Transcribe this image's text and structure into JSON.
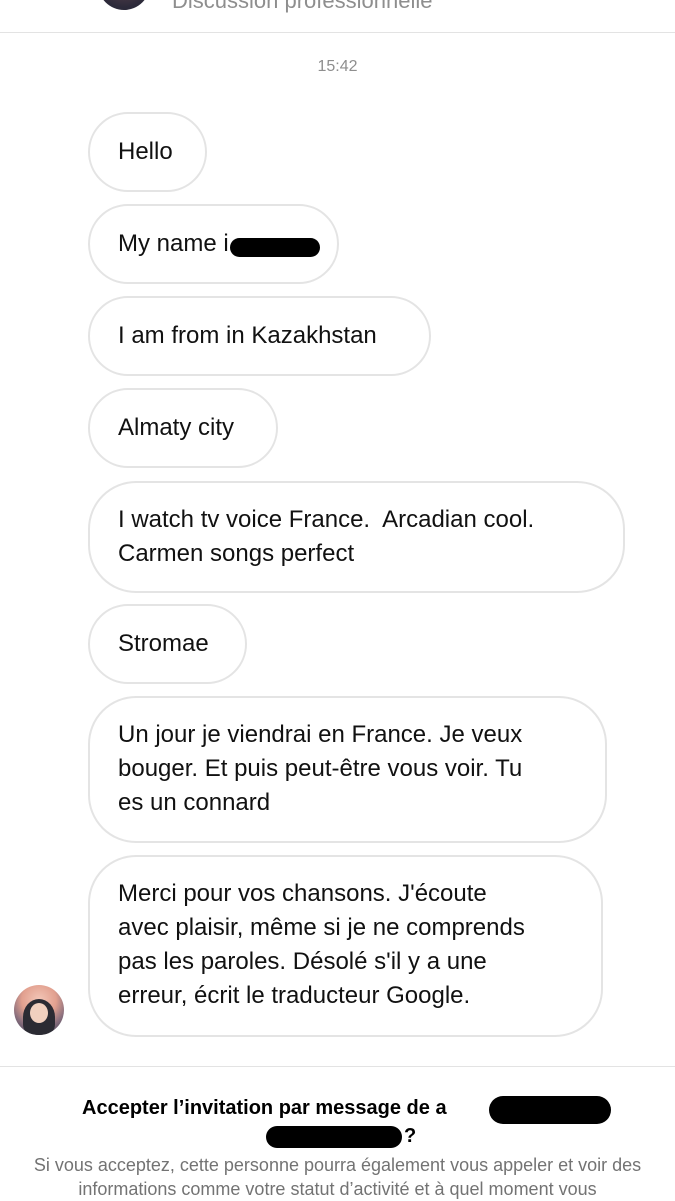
{
  "header": {
    "subtitle": "Discussion professionnelle"
  },
  "timestamp": "15:42",
  "messages": [
    {
      "text": "Hello"
    },
    {
      "text": "My name i",
      "redacted": true
    },
    {
      "text": "I am from in Kazakhstan"
    },
    {
      "text": "Almaty city"
    },
    {
      "text": "I watch tv voice France.  Arcadian cool.\nCarmen songs perfect"
    },
    {
      "text": "Stromae"
    },
    {
      "text": "Un jour je viendrai en France. Je veux\nbouger. Et puis peut-être vous voir. Tu\nes un connard"
    },
    {
      "text": "Merci pour vos chansons. J'écoute\navec plaisir, même si je ne comprends\npas les paroles. Désolé s'il y a une\nerreur, écrit le traducteur Google."
    }
  ],
  "invite": {
    "title": "Accepter l’invitation par message de a",
    "question_mark": "?",
    "description": "Si vous acceptez, cette personne pourra également vous appeler et voir des informations comme votre statut d’activité et à quel moment vous"
  },
  "colors": {
    "bubble_border": "#e4e4e4",
    "muted_text": "#8e8e8e",
    "redaction": "#000000"
  }
}
